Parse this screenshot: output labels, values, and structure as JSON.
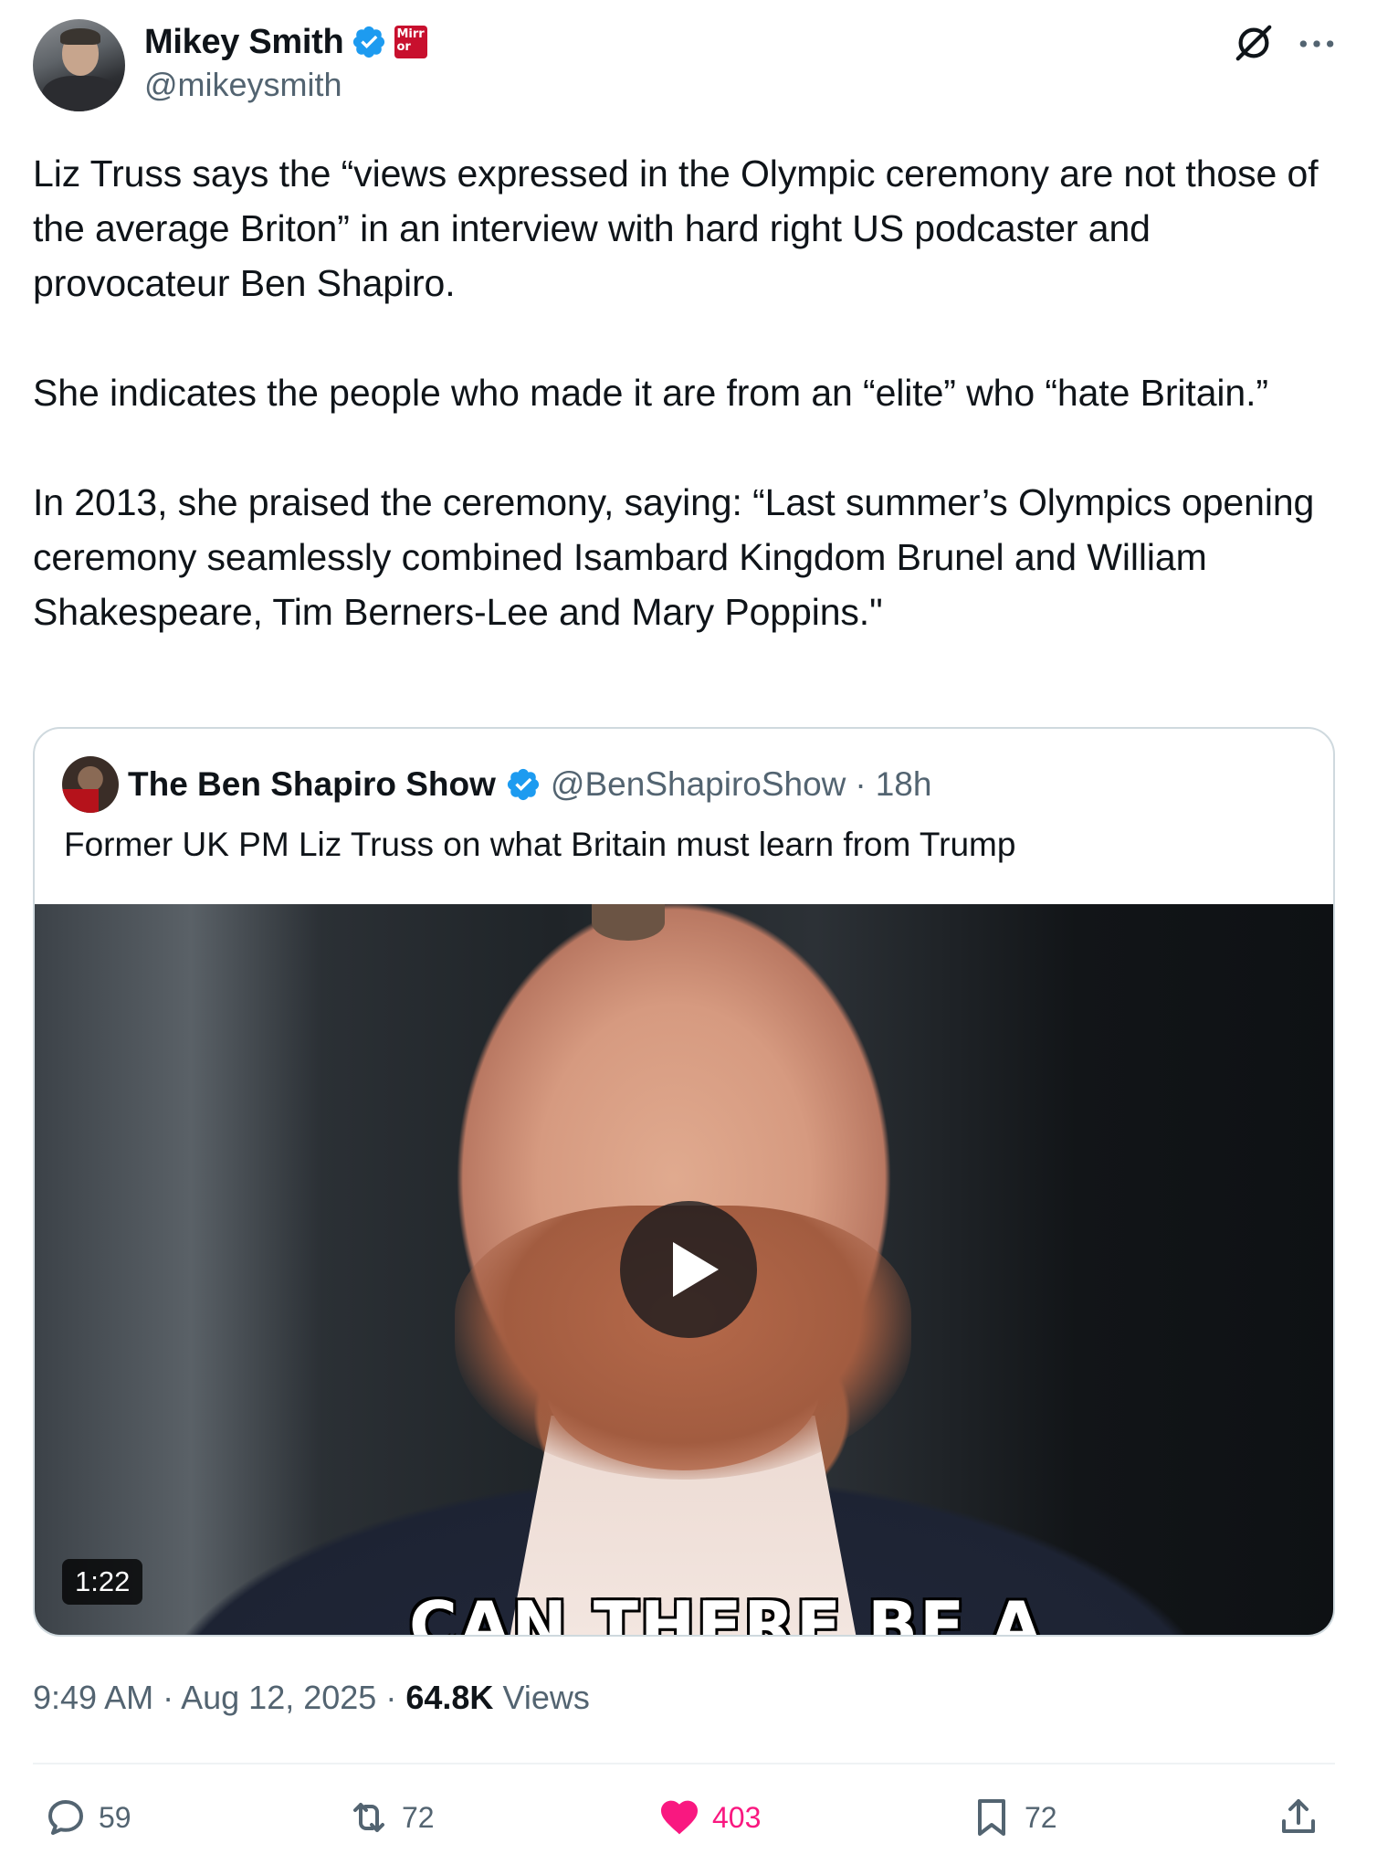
{
  "author": {
    "display_name": "Mikey Smith",
    "handle": "@mikeysmith",
    "affiliation_badge": "Mirror"
  },
  "tweet_text": "Liz Truss says the “views expressed in the Olympic ceremony are not those of the average Briton” in an interview with hard right US podcaster and provocateur Ben Shapiro.\n\nShe indicates the people who made it are from an “elite” who “hate Britain.”\n\nIn 2013, she praised the ceremony, saying: “Last summer’s Olympics opening ceremony seamlessly combined Isambard Kingdom Brunel and William Shakespeare, Tim Berners-Lee and Mary Poppins.\"",
  "quoted": {
    "display_name": "The Ben Shapiro Show",
    "handle": "@BenShapiroShow",
    "separator": "·",
    "time": "18h",
    "text": "Former UK PM Liz Truss on what Britain must learn from Trump",
    "video_duration": "1:22",
    "video_caption": "CAN THERE BE A"
  },
  "meta": {
    "time": "9:49 AM",
    "separator": "·",
    "date": "Aug 12, 2025",
    "views_count": "64.8K",
    "views_label": "Views"
  },
  "actions": {
    "replies": "59",
    "reposts": "72",
    "likes": "403",
    "bookmarks": "72"
  },
  "colors": {
    "verified": "#1d9bf0",
    "like": "#f91880",
    "secondary_text": "#536471",
    "affiliation": "#c8102e"
  },
  "icons": [
    "verified-badge-icon",
    "grok-icon",
    "more-icon",
    "play-icon",
    "reply-icon",
    "repost-icon",
    "heart-icon",
    "bookmark-icon",
    "share-icon"
  ]
}
